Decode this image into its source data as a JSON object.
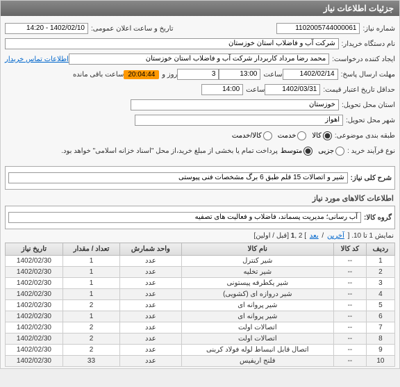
{
  "header": {
    "title": "جزئیات اطلاعات نیاز"
  },
  "form": {
    "need_no_lbl": "شماره نیاز:",
    "need_no": "1102005744000061",
    "announce_lbl": "تاریخ و ساعت اعلان عمومی:",
    "announce": "1402/02/10 - 14:20",
    "buyer_lbl": "نام دستگاه خریدار:",
    "buyer": "شرکت آب و فاضلاب استان خوزستان",
    "creator_lbl": "ایجاد کننده درخواست:",
    "creator": "محمد رضا مرداد کاربردار شرکت آب و فاضلاب استان خوزستان",
    "contact_link": "اطلاعات تماس خریدار",
    "deadline_lbl": "مهلت ارسال پاسخ:",
    "deadline_date": "1402/02/14",
    "saat_lbl": "ساعت",
    "deadline_time": "13:00",
    "rooz_lbl": "روز و",
    "days": "3",
    "countdown": "20:04:44",
    "remaining_lbl": "ساعت باقی مانده",
    "valid_lbl": "حداقل تاریخ اعتبار قیمت:",
    "valid_date": "1402/03/31",
    "valid_time": "14:00",
    "province_lbl": "استان محل تحویل:",
    "province": "خوزستان",
    "city_lbl": "شهر محل تحویل:",
    "city": "اهواز",
    "cat_lbl": "طبقه بندی موضوعی:",
    "cat_opts": {
      "a": "کالا",
      "b": "خدمت",
      "c": "کالا/خدمت"
    },
    "type_lbl": "نوع فرآیند خرید :",
    "type_opts": {
      "a": "جزیی",
      "b": "متوسط"
    },
    "note": "پرداخت تمام یا بخشی از مبلغ خرید،از محل \"اسناد خزانه اسلامی\" خواهد بود."
  },
  "desc": {
    "lbl": "شرح کلی نیاز:",
    "text": "شیر و اتصالات 15 قلم طبق 6 برگ مشخصات فنی پیوستی"
  },
  "items_header": "اطلاعات کالاهای مورد نیاز",
  "group": {
    "lbl": "گروه کالا:",
    "text": "آب رسانی؛ مدیریت پسماند، فاضلاب و فعالیت های تصفیه"
  },
  "paging": {
    "prefix": "نمایش 1 تا 10. [ ",
    "last": "آخرین",
    "sep": " / ",
    "next": "بعد",
    "mid": " ] 2 ,",
    "cur": "1",
    "suffix": " [قبل / اولین]"
  },
  "table": {
    "headers": {
      "row": "ردیف",
      "code": "کد کالا",
      "name": "نام کالا",
      "unit": "واحد شمارش",
      "qty": "تعداد / مقدار",
      "date": "تاریخ نیاز"
    },
    "rows": [
      {
        "r": "1",
        "code": "--",
        "name": "شیر کنترل",
        "unit": "عدد",
        "qty": "1",
        "date": "1402/02/30"
      },
      {
        "r": "2",
        "code": "--",
        "name": "شیر تخلیه",
        "unit": "عدد",
        "qty": "1",
        "date": "1402/02/30"
      },
      {
        "r": "3",
        "code": "--",
        "name": "شیر یکطرفه پیستونی",
        "unit": "عدد",
        "qty": "1",
        "date": "1402/02/30"
      },
      {
        "r": "4",
        "code": "--",
        "name": "شیر دروازه ای (کشویی)",
        "unit": "عدد",
        "qty": "1",
        "date": "1402/02/30"
      },
      {
        "r": "5",
        "code": "--",
        "name": "شیر پروانه ای",
        "unit": "عدد",
        "qty": "2",
        "date": "1402/02/30"
      },
      {
        "r": "6",
        "code": "--",
        "name": "شیر پروانه ای",
        "unit": "عدد",
        "qty": "1",
        "date": "1402/02/30"
      },
      {
        "r": "7",
        "code": "--",
        "name": "اتصالات اولت",
        "unit": "عدد",
        "qty": "2",
        "date": "1402/02/30"
      },
      {
        "r": "8",
        "code": "--",
        "name": "اتصالات اولت",
        "unit": "عدد",
        "qty": "2",
        "date": "1402/02/30"
      },
      {
        "r": "9",
        "code": "--",
        "name": "اتصال قابل انبساط لوله فولاد کربنی",
        "unit": "عدد",
        "qty": "2",
        "date": "1402/02/30"
      },
      {
        "r": "10",
        "code": "--",
        "name": "فلنج اریفیس",
        "unit": "عدد",
        "qty": "33",
        "date": "1402/02/30"
      }
    ]
  }
}
